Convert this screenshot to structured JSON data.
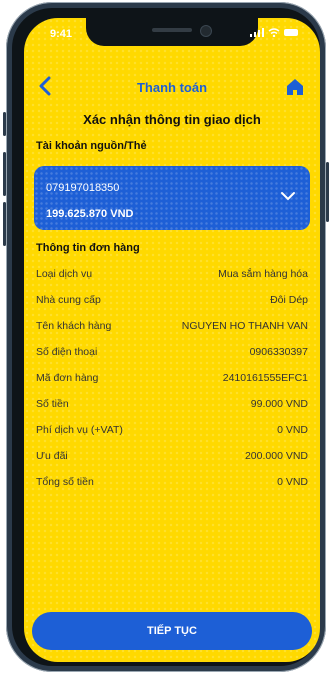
{
  "status": {
    "time": "9:41"
  },
  "header": {
    "title": "Thanh toán",
    "back_icon": "back-arrow-icon",
    "home_icon": "home-icon"
  },
  "confirm_title": "Xác nhận thông tin giao dịch",
  "source": {
    "label": "Tài khoản nguồn/Thẻ",
    "account_number": "079197018350",
    "balance": "199.625.870 VND"
  },
  "order": {
    "label": "Thông tin đơn hàng",
    "rows": [
      {
        "label": "Loại dịch vụ",
        "value": "Mua sắm hàng hóa"
      },
      {
        "label": "Nhà cung cấp",
        "value": "Đôi Dép"
      },
      {
        "label": "Tên khách hàng",
        "value": "NGUYEN HO THANH VAN"
      },
      {
        "label": "Số điện thoại",
        "value": "0906330397"
      },
      {
        "label": "Mã đơn hàng",
        "value": "2410161555EFC1"
      },
      {
        "label": "Số tiền",
        "value": "99.000 VND"
      },
      {
        "label": "Phí dịch vụ (+VAT)",
        "value": "0 VND"
      },
      {
        "label": "Ưu đãi",
        "value": "200.000 VND"
      },
      {
        "label": "Tổng số tiền",
        "value": "0 VND"
      }
    ]
  },
  "actions": {
    "continue_label": "TIẾP TỤC"
  },
  "colors": {
    "accent": "#1d5fd6",
    "background": "#ffd900"
  }
}
